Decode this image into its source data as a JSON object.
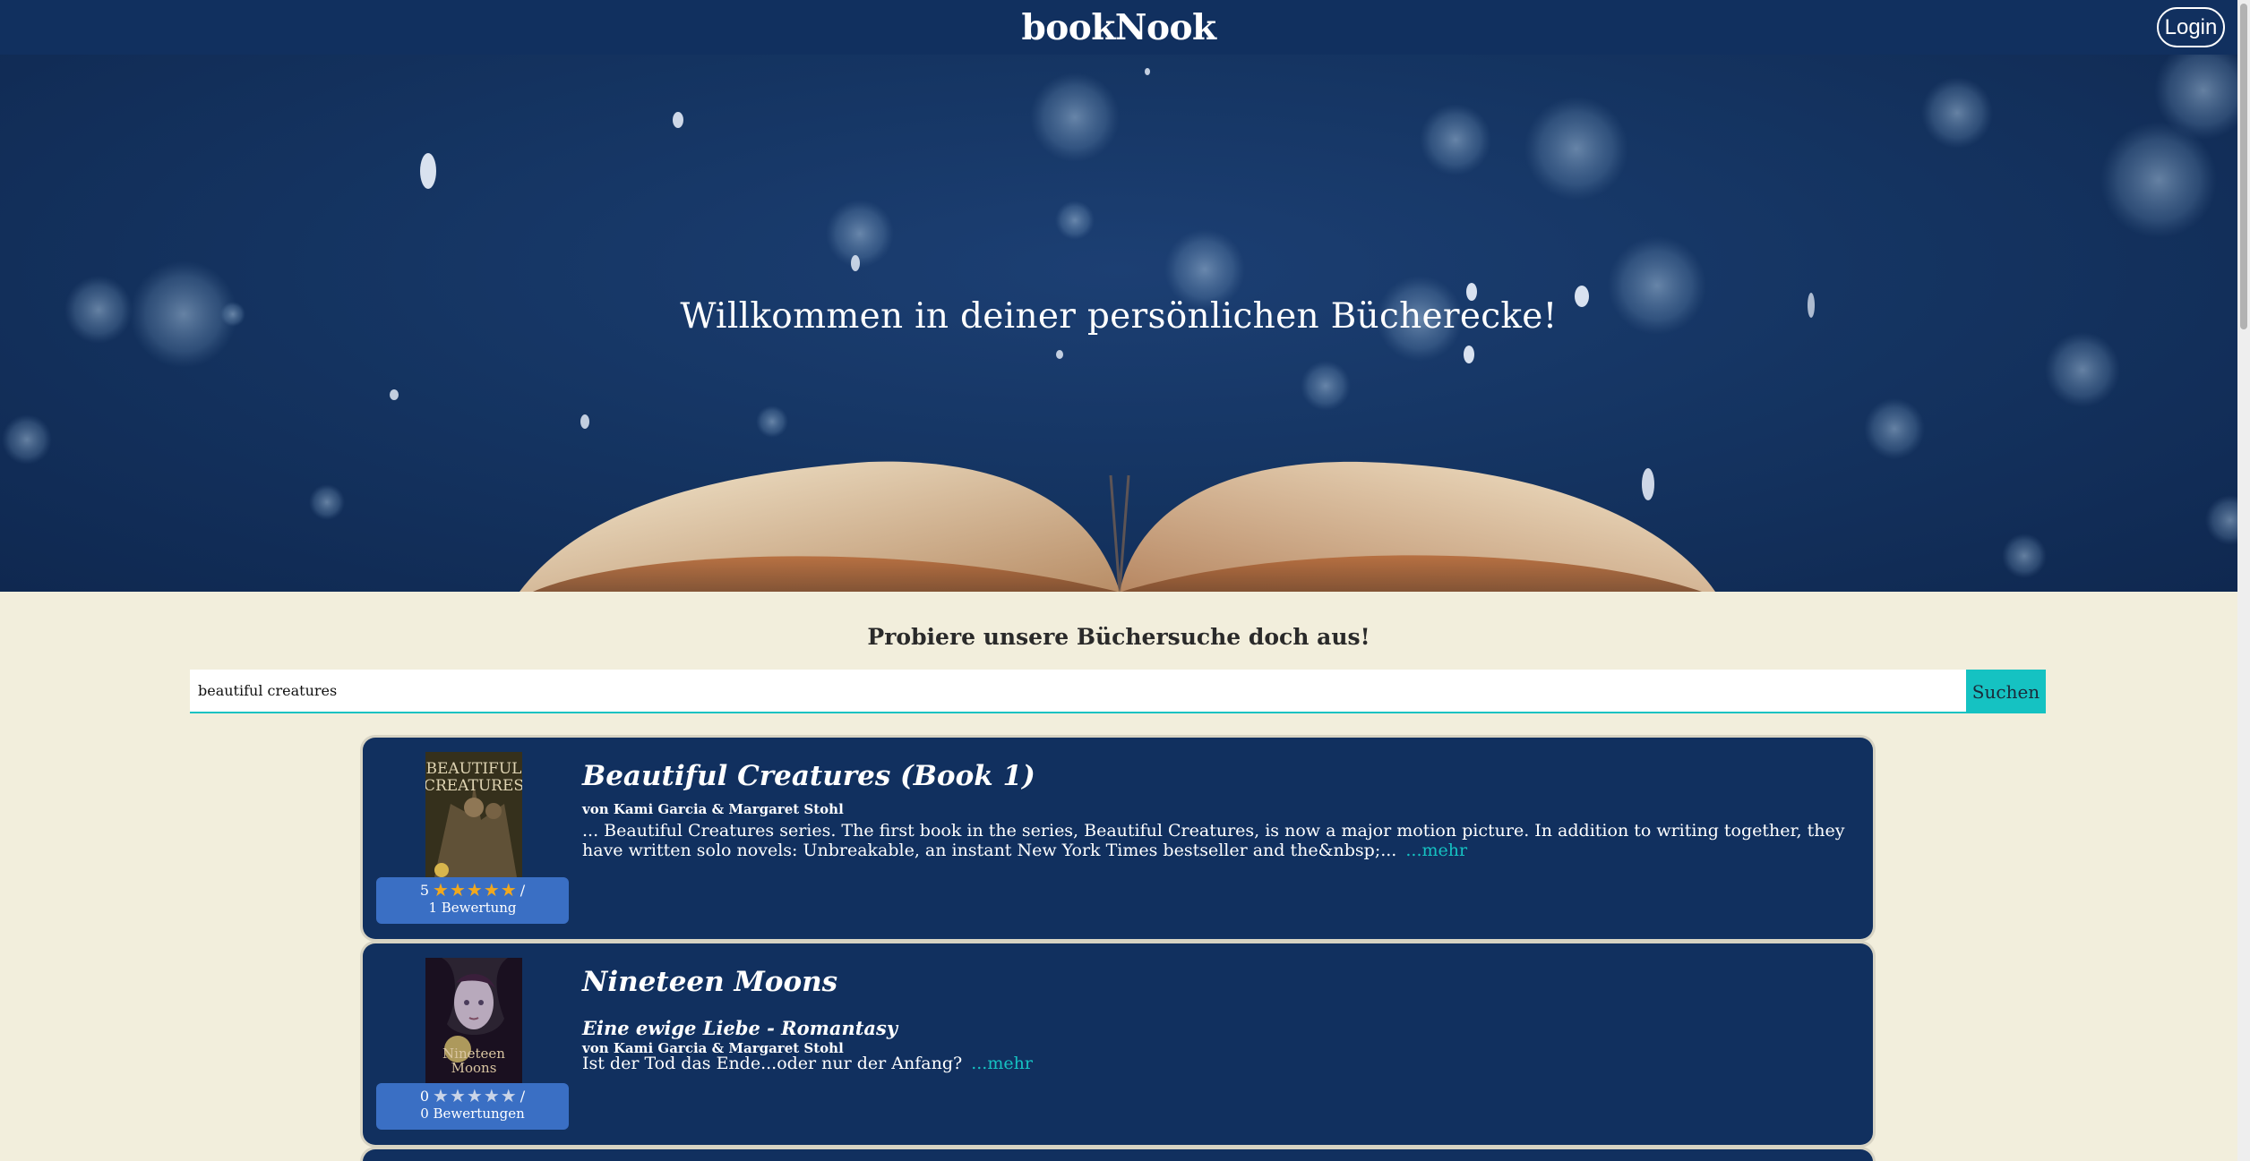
{
  "header": {
    "brand": "bookNook",
    "login_label": "Login"
  },
  "hero": {
    "title": "Willkommen in deiner persönlichen Bücherecke!"
  },
  "search": {
    "heading": "Probiere unsere Büchersuche doch aus!",
    "value": "beautiful creatures",
    "button_label": "Suchen"
  },
  "results": [
    {
      "title": "Beautiful Creatures (Book 1)",
      "subtitle": "",
      "author": "von Kami Garcia & Margaret Stohl",
      "description": "... Beautiful Creatures series. The first book in the series, Beautiful Creatures, is now a major motion picture. In addition to writing together, they have written solo novels: Unbreakable, an instant New York Times bestseller and the&nbsp;...",
      "more_label": "...mehr",
      "rating_value": "5",
      "rating_filled": 5,
      "rating_suffix": "/",
      "rating_count": "1 Bewertung",
      "cover_text": "BEAUTIFUL CREATURES"
    },
    {
      "title": "Nineteen Moons",
      "subtitle": "Eine ewige Liebe - Romantasy",
      "author": "von Kami Garcia & Margaret Stohl",
      "description": "Ist der Tod das Ende...oder nur der Anfang?",
      "more_label": "...mehr",
      "rating_value": "0",
      "rating_filled": 0,
      "rating_suffix": "/",
      "rating_count": "0 Bewertungen",
      "cover_text": "Nineteen Moons"
    }
  ],
  "icons": {
    "star": "★",
    "book_cover_1": "book-cover-beautiful-creatures",
    "book_cover_2": "book-cover-nineteen-moons"
  },
  "colors": {
    "header": "#11305f",
    "accent": "#15c2c2",
    "page_background": "#f2eedc",
    "rating_box": "#3a6fc4",
    "star_filled": "#f1a81e"
  }
}
